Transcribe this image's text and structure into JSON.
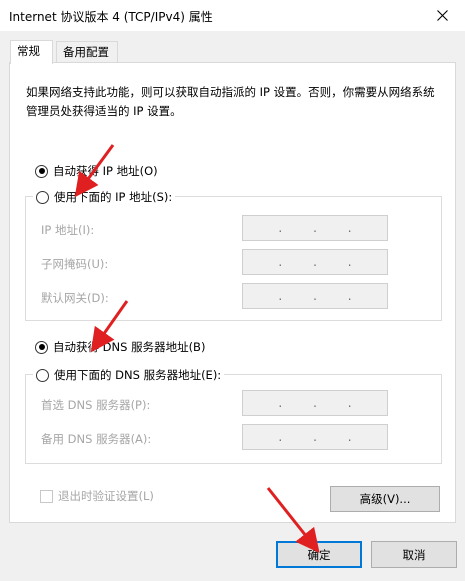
{
  "window": {
    "title": "Internet 协议版本 4 (TCP/IPv4) 属性"
  },
  "tabs": [
    {
      "label": "常规",
      "active": true
    },
    {
      "label": "备用配置",
      "active": false
    }
  ],
  "description": "如果网络支持此功能，则可以获取自动指派的 IP 设置。否则，你需要从网络系统管理员处获得适当的 IP 设置。",
  "ip_section": {
    "auto_label": "自动获得 IP 地址(O)",
    "manual_label": "使用下面的 IP 地址(S):",
    "auto_selected": true,
    "fields": [
      {
        "label": "IP 地址(I):",
        "value": ".   .   ."
      },
      {
        "label": "子网掩码(U):",
        "value": ".   .   ."
      },
      {
        "label": "默认网关(D):",
        "value": ".   .   ."
      }
    ]
  },
  "dns_section": {
    "auto_label": "自动获得 DNS 服务器地址(B)",
    "manual_label": "使用下面的 DNS 服务器地址(E):",
    "auto_selected": true,
    "fields": [
      {
        "label": "首选 DNS 服务器(P):",
        "value": ".   .   ."
      },
      {
        "label": "备用 DNS 服务器(A):",
        "value": ".   .   ."
      }
    ]
  },
  "validate_label": "退出时验证设置(L)",
  "advanced_label": "高级(V)...",
  "ok_label": "确定",
  "cancel_label": "取消",
  "colors": {
    "arrow": "#e02020",
    "focus": "#0078d7"
  }
}
